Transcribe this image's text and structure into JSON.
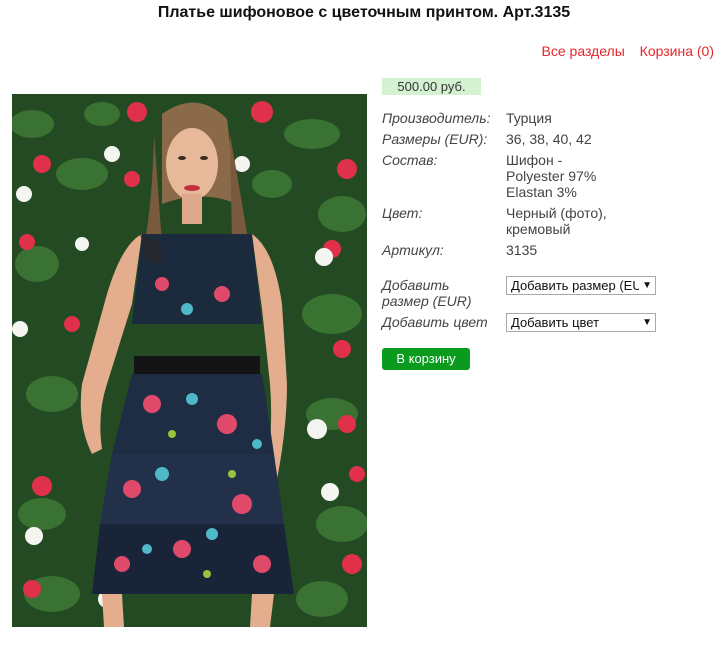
{
  "page": {
    "title": "Платье шифоновое с цветочным принтом. Арт.3135"
  },
  "nav": {
    "all_sections": "Все разделы",
    "cart": "Корзина (0)"
  },
  "product": {
    "price": "500.00 руб.",
    "properties": [
      {
        "label": "Производитель:",
        "value": [
          "Турция"
        ]
      },
      {
        "label": "Размеры (EUR):",
        "value": [
          "36, 38, 40, 42"
        ]
      },
      {
        "label": "Состав:",
        "value": [
          "Шифон -",
          "Polyester 97%",
          "Elastan 3%"
        ]
      },
      {
        "label": "Цвет:",
        "value": [
          "Черный (фото),",
          "кремовый"
        ]
      },
      {
        "label": "Артикул:",
        "value": [
          "3135"
        ]
      }
    ],
    "add_size": {
      "label_line1": "Добавить",
      "label_line2": "размер (EUR)",
      "selected": "Добавить размер (EUR)"
    },
    "add_color": {
      "label": "Добавить цвет",
      "selected": "Добавить цвет"
    },
    "cart_button": "В корзину"
  },
  "colors": {
    "link": "#e8242b",
    "price_bg": "#d4f2d1",
    "button_bg": "#0a9a1e"
  }
}
